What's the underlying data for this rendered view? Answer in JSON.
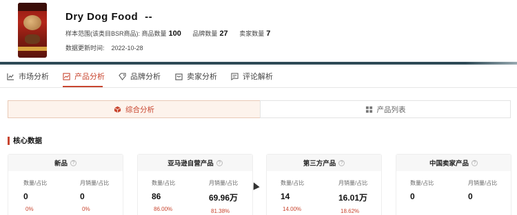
{
  "header": {
    "title": "Dry Dog Food",
    "title_suffix": "--",
    "sample_scope_label": "样本范围(该类目BSR商品):",
    "product_count_label": "商品数量",
    "product_count": "100",
    "brand_count_label": "品牌数量",
    "brand_count": "27",
    "seller_count_label": "卖家数量",
    "seller_count": "7",
    "update_label": "数据更新时间:",
    "update_date": "2022-10-28"
  },
  "colors": {
    "accent": "#c8452f",
    "bar": "#2e4a56"
  },
  "tabs": [
    {
      "label": "市场分析",
      "icon": "line-chart-icon"
    },
    {
      "label": "产品分析",
      "icon": "area-chart-icon",
      "active": true
    },
    {
      "label": "品牌分析",
      "icon": "tag-icon"
    },
    {
      "label": "卖家分析",
      "icon": "shop-icon"
    },
    {
      "label": "评论解析",
      "icon": "comment-icon"
    }
  ],
  "toggles": [
    {
      "label": "综合分析",
      "icon": "cube-icon",
      "active": true
    },
    {
      "label": "产品列表",
      "icon": "grid-icon"
    }
  ],
  "section": {
    "title": "核心数据"
  },
  "cards": [
    {
      "title": "新品",
      "col1_label": "数量/占比",
      "col1_value": "0",
      "col1_pct": "0%",
      "col2_label": "月销量/占比",
      "col2_value": "0",
      "col2_pct": "0%"
    },
    {
      "title": "亚马逊自营产品",
      "col1_label": "数量/占比",
      "col1_value": "86",
      "col1_pct": "86.00%",
      "col2_label": "月销量/占比",
      "col2_value": "69.96万",
      "col2_pct": "81.38%"
    },
    {
      "title": "第三方产品",
      "col1_label": "数量/占比",
      "col1_value": "14",
      "col1_pct": "14.00%",
      "col2_label": "月销量/占比",
      "col2_value": "16.01万",
      "col2_pct": "18.62%"
    },
    {
      "title": "中国卖家产品",
      "col1_label": "数量/占比",
      "col1_value": "0",
      "col1_pct": "",
      "col2_label": "月销量/占比",
      "col2_value": "0",
      "col2_pct": ""
    }
  ]
}
